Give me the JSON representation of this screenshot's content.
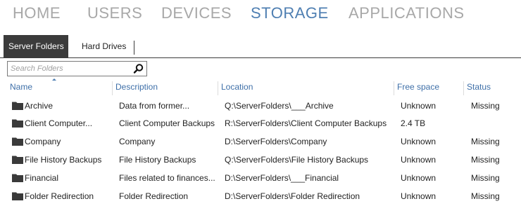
{
  "nav": {
    "items": [
      {
        "label": "HOME"
      },
      {
        "label": "USERS"
      },
      {
        "label": "DEVICES"
      },
      {
        "label": "STORAGE",
        "active": true
      },
      {
        "label": "APPLICATIONS"
      }
    ]
  },
  "subtabs": {
    "server_folders": "Server Folders",
    "hard_drives": "Hard Drives"
  },
  "search": {
    "placeholder": "Search Folders",
    "icon": "search-icon"
  },
  "columns": {
    "name": "Name",
    "description": "Description",
    "location": "Location",
    "free_space": "Free space",
    "status": "Status"
  },
  "folders": [
    {
      "name": "Archive",
      "description": "Data from former...",
      "location": "Q:\\ServerFolders\\___Archive",
      "free_space": "Unknown",
      "status": "Missing"
    },
    {
      "name": "Client Computer...",
      "description": "Client Computer Backups",
      "location": "R:\\ServerFolders\\Client Computer Backups",
      "free_space": "2.4 TB",
      "status": ""
    },
    {
      "name": "Company",
      "description": "Company",
      "location": "D:\\ServerFolders\\Company",
      "free_space": "Unknown",
      "status": "Missing"
    },
    {
      "name": "File History Backups",
      "description": "File History Backups",
      "location": "Q:\\ServerFolders\\File History Backups",
      "free_space": "Unknown",
      "status": "Missing"
    },
    {
      "name": "Financial",
      "description": "Files related to finances...",
      "location": "D:\\ServerFolders\\___Financial",
      "free_space": "Unknown",
      "status": "Missing"
    },
    {
      "name": "Folder Redirection",
      "description": "Folder Redirection",
      "location": "D:\\ServerFolders\\Folder Redirection",
      "free_space": "Unknown",
      "status": "Missing"
    }
  ],
  "colors": {
    "accent": "#4f7fb2",
    "nav_inactive": "#a8a8a8",
    "tab_active_bg": "#3b3b3b"
  }
}
